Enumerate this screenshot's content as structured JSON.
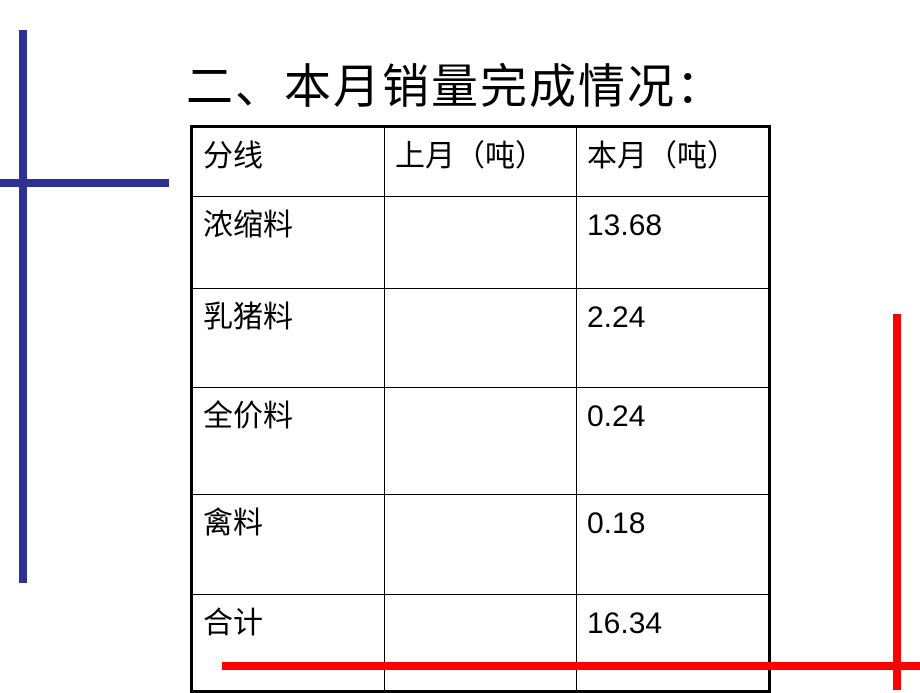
{
  "title": "二、本月销量完成情况：",
  "colors": {
    "left_decoration": "#2e3192",
    "right_decoration": "#ff0000",
    "table_border": "#000000"
  },
  "table": {
    "headers": [
      "分线",
      "上月（吨）",
      "本月（吨）"
    ],
    "rows": [
      {
        "line": "浓缩料",
        "last_month": "",
        "this_month": "13.68"
      },
      {
        "line": "乳猪料",
        "last_month": "",
        "this_month": "2.24"
      },
      {
        "line": "全价料",
        "last_month": "",
        "this_month": "0.24"
      },
      {
        "line": "禽料",
        "last_month": "",
        "this_month": "0.18"
      },
      {
        "line": "合计",
        "last_month": "",
        "this_month": "16.34"
      }
    ]
  }
}
